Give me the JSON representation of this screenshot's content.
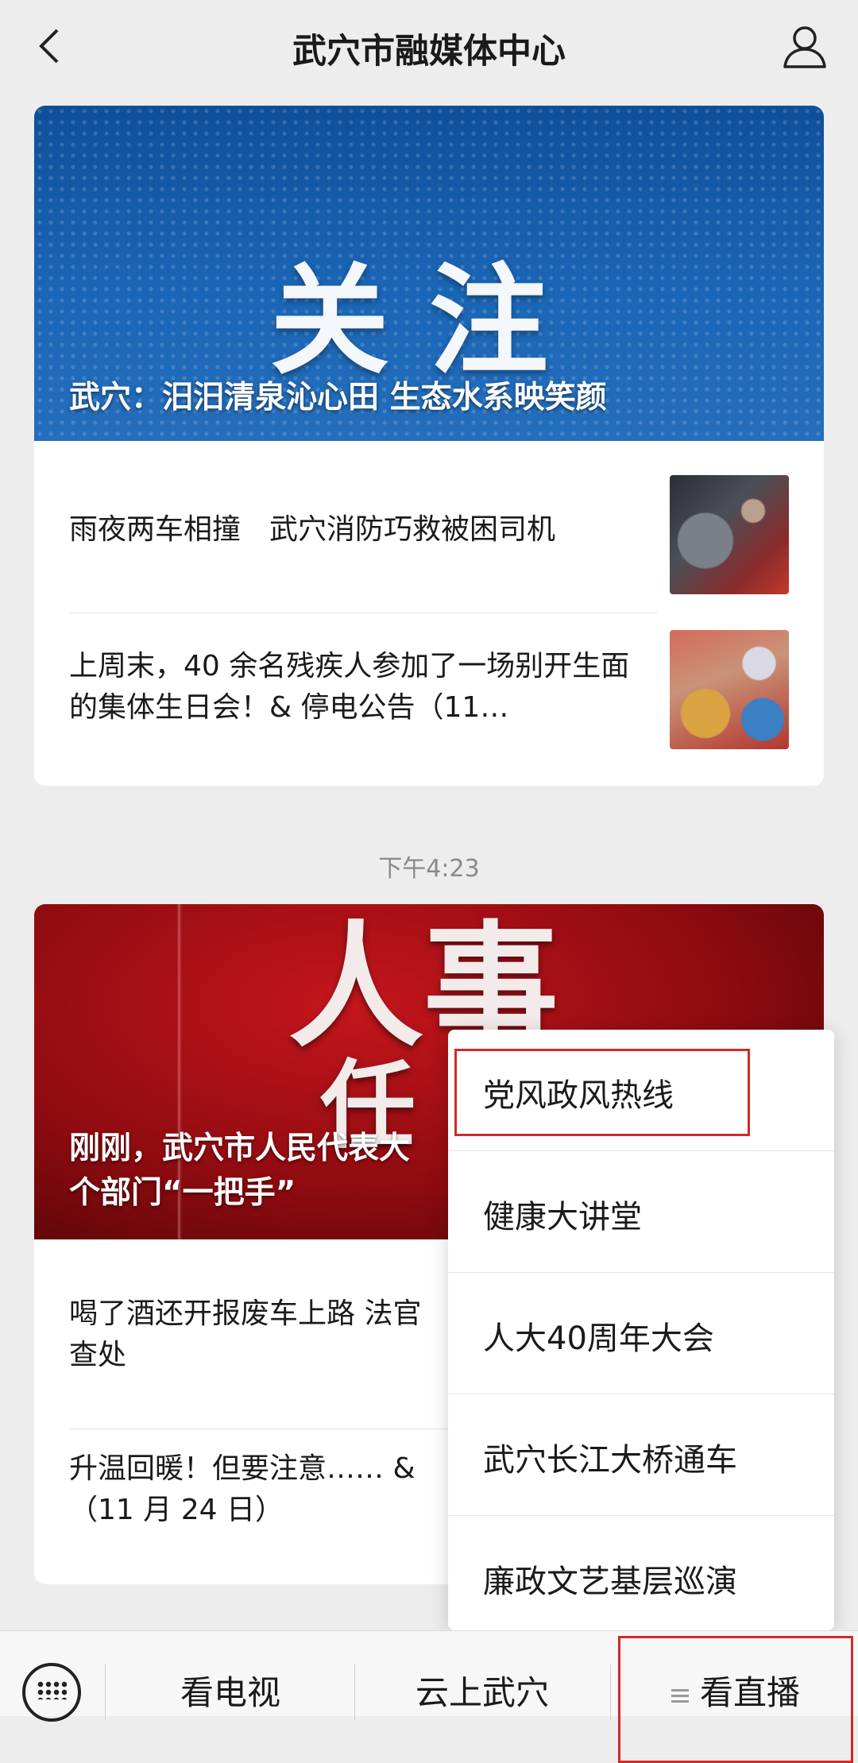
{
  "header": {
    "title": "武穴市融媒体中心"
  },
  "card1": {
    "banner_text": "关注",
    "headline": "武穴：汨汨清泉沁心田 生态水系映笑颜",
    "items": [
      {
        "text": "雨夜两车相撞　武穴消防巧救被困司机"
      },
      {
        "text": "上周末，40 余名残疾人参加了一场别开生面的集体生日会！& 停电公告（11…"
      }
    ]
  },
  "timestamp": "下午4:23",
  "card2": {
    "banner_text_line1": "人事",
    "banner_text_line2": "任",
    "headline_line1": "刚刚，武穴市人民代表大",
    "headline_line2": "个部门“一把手”",
    "items": [
      {
        "line1": "喝了酒还开报废车上路 法官",
        "line2": "查处"
      },
      {
        "line1": "升温回暖！但要注意…… &",
        "line2": "（11 月 24 日）"
      }
    ]
  },
  "popup_menu": {
    "items": [
      {
        "label": "党风政风热线"
      },
      {
        "label": "健康大讲堂"
      },
      {
        "label": "人大40周年大会"
      },
      {
        "label": "武穴长江大桥通车"
      },
      {
        "label": "廉政文艺基层巡演"
      }
    ]
  },
  "bottom_bar": {
    "tabs": [
      {
        "label": "看电视"
      },
      {
        "label": "云上武穴"
      },
      {
        "label": "看直播"
      }
    ]
  },
  "colors": {
    "highlight_red": "#d12a2a",
    "banner_blue": "#1a66b6",
    "banner_red": "#a8121a"
  }
}
